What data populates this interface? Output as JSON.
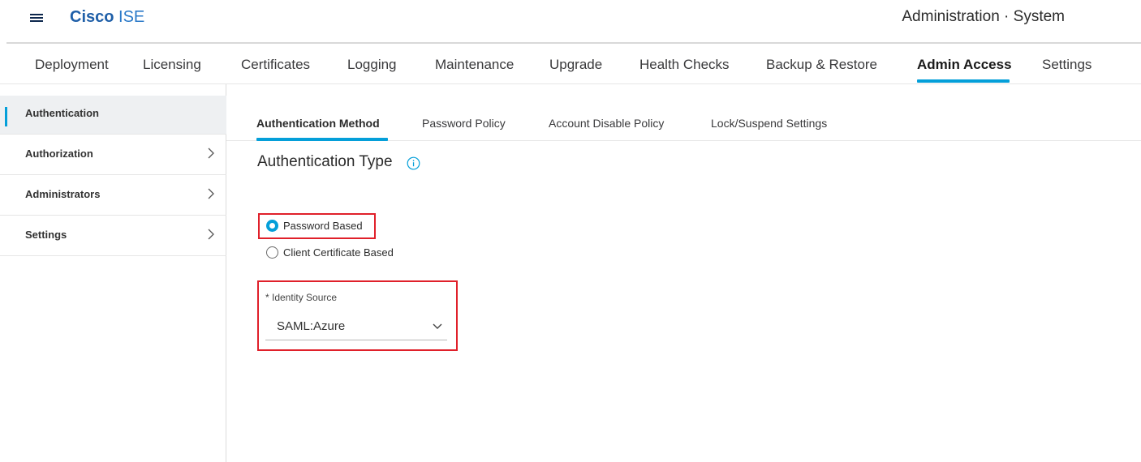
{
  "header": {
    "menu_icon": "hamburger-menu-icon",
    "brand_bold": "Cisco",
    "brand_rest": " ISE",
    "breadcrumb": "Administration · System"
  },
  "topnav": {
    "tabs": [
      {
        "label": "Deployment",
        "active": false
      },
      {
        "label": "Licensing",
        "active": false
      },
      {
        "label": "Certificates",
        "active": false
      },
      {
        "label": "Logging",
        "active": false
      },
      {
        "label": "Maintenance",
        "active": false
      },
      {
        "label": "Upgrade",
        "active": false
      },
      {
        "label": "Health Checks",
        "active": false
      },
      {
        "label": "Backup & Restore",
        "active": false
      },
      {
        "label": "Admin Access",
        "active": true
      },
      {
        "label": "Settings",
        "active": false
      }
    ],
    "accent_color": "#049fd9"
  },
  "sidebar": {
    "items": [
      {
        "label": "Authentication",
        "active": true,
        "has_chevron": false
      },
      {
        "label": "Authorization",
        "active": false,
        "has_chevron": true
      },
      {
        "label": "Administrators",
        "active": false,
        "has_chevron": true
      },
      {
        "label": "Settings",
        "active": false,
        "has_chevron": true
      }
    ]
  },
  "subtabs": {
    "tabs": [
      {
        "label": "Authentication Method",
        "active": true
      },
      {
        "label": "Password Policy",
        "active": false
      },
      {
        "label": "Account Disable Policy",
        "active": false
      },
      {
        "label": "Lock/Suspend Settings",
        "active": false
      }
    ]
  },
  "main": {
    "section_title": "Authentication Type",
    "info_icon": "info-circle-icon",
    "auth_options": [
      {
        "label": "Password Based",
        "checked": true
      },
      {
        "label": "Client Certificate Based",
        "checked": false
      }
    ],
    "identity_source": {
      "label": "* Identity Source",
      "value": "SAML:Azure"
    },
    "highlight_color": "#e0202a"
  }
}
